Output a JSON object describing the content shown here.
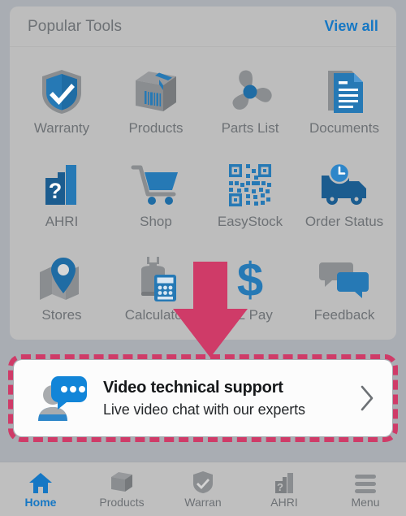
{
  "colors": {
    "page_background": "#a9adb3",
    "card_background": "#bdbdbd",
    "accent_blue": "#1577c4",
    "icon_gray": "#8a8d90",
    "highlight_crimson": "#cf3b68",
    "label_gray": "#6d7175",
    "nav_background": "#bfbfbf",
    "support_card_background": "#fcfcfc"
  },
  "tools_card": {
    "title": "Popular Tools",
    "view_all_label": "View all",
    "tiles": [
      {
        "label": "Warranty",
        "icon": "shield-check-icon"
      },
      {
        "label": "Products",
        "icon": "box-barcode-icon"
      },
      {
        "label": "Parts List",
        "icon": "fan-blade-icon"
      },
      {
        "label": "Documents",
        "icon": "document-icon"
      },
      {
        "label": "AHRI",
        "icon": "bar-chart-question-icon"
      },
      {
        "label": "Shop",
        "icon": "shopping-cart-icon"
      },
      {
        "label": "EasyStock",
        "icon": "qr-code-icon"
      },
      {
        "label": "Order Status",
        "icon": "delivery-truck-clock-icon"
      },
      {
        "label": "Stores",
        "icon": "map-pin-icon"
      },
      {
        "label": "Calculator",
        "icon": "gas-cylinder-calculator-icon"
      },
      {
        "label": "EZ Pay",
        "icon": "dollar-sign-icon"
      },
      {
        "label": "Feedback",
        "icon": "chat-bubbles-icon"
      }
    ]
  },
  "annotation": {
    "arrow_icon": "down-arrow-annotation",
    "arrow_color": "#cf3b68",
    "highlight_border_color": "#cf3b68"
  },
  "video_support": {
    "icon": "video-chat-support-icon",
    "title": "Video technical support",
    "subtitle": "Live video chat with our experts",
    "chevron_icon": "chevron-right-icon"
  },
  "bottom_nav": {
    "items": [
      {
        "label": "Home",
        "icon": "home-icon",
        "active": true
      },
      {
        "label": "Products",
        "icon": "box-icon",
        "active": false
      },
      {
        "label": "Warran",
        "icon": "shield-check-icon",
        "active": false
      },
      {
        "label": "AHRI",
        "icon": "bar-chart-icon",
        "active": false
      },
      {
        "label": "Menu",
        "icon": "hamburger-menu-icon",
        "active": false
      }
    ]
  }
}
